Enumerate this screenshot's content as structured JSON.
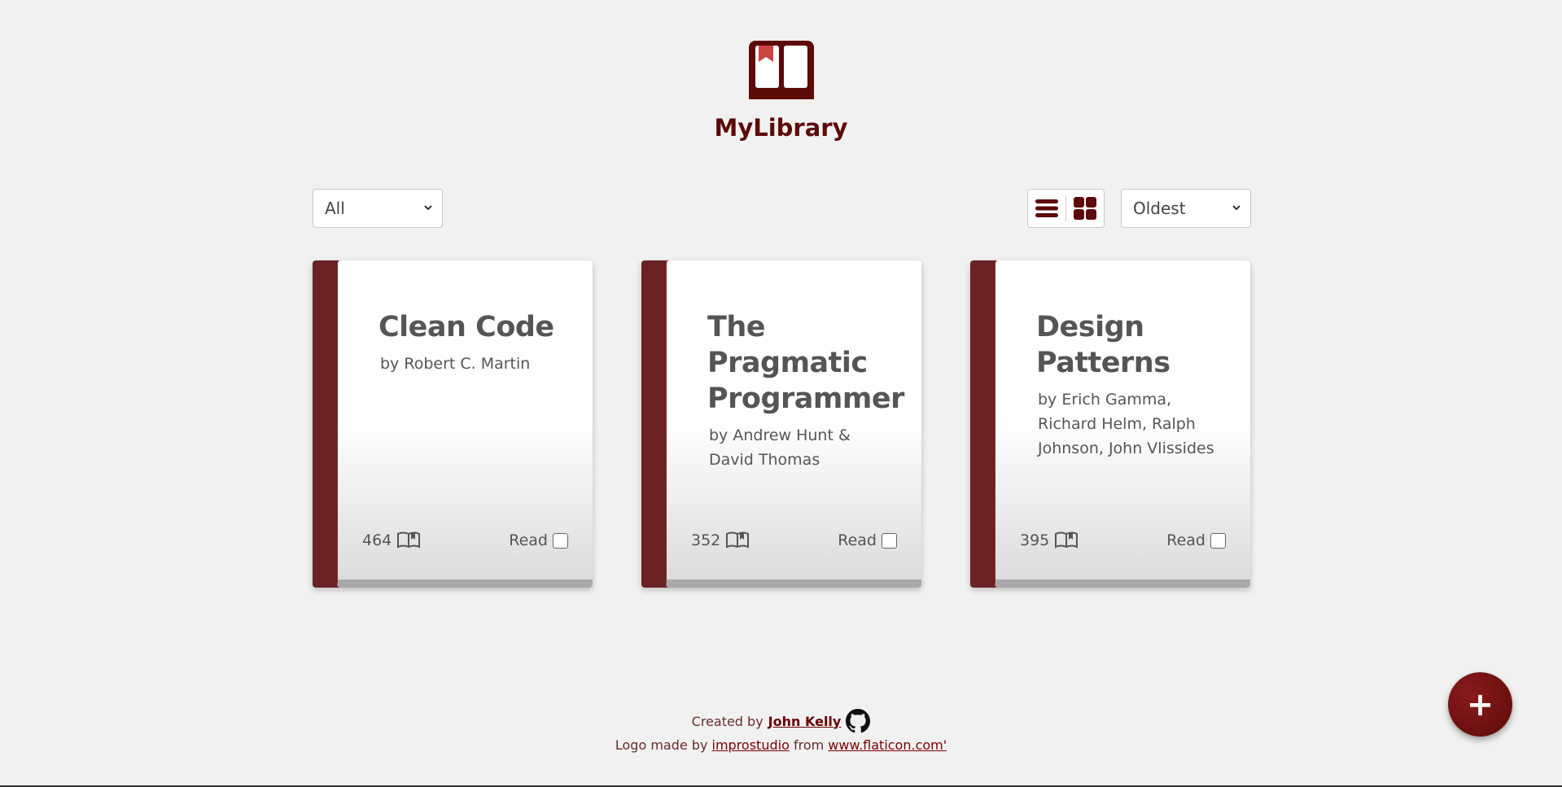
{
  "app": {
    "title": "MyLibrary",
    "logo_icon": "open-book-bookmark-icon",
    "brand_color": "#5c0a0a"
  },
  "controls": {
    "filter_value": "All",
    "sort_value": "Oldest",
    "view_list_icon": "list-view-icon",
    "view_grid_icon": "grid-view-icon"
  },
  "books": [
    {
      "title": "Clean Code",
      "author": "by Robert C. Martin",
      "pages": "464",
      "read_label": "Read",
      "read": false
    },
    {
      "title": "The Pragmatic Programmer",
      "author": "by Andrew Hunt & David Thomas",
      "pages": "352",
      "read_label": "Read",
      "read": false
    },
    {
      "title": "Design Patterns",
      "author": "by Erich Gamma, Richard Helm, Ralph Johnson, John Vlissides",
      "pages": "395",
      "read_label": "Read",
      "read": false
    }
  ],
  "footer": {
    "created_by": "Created by",
    "author_name": "John Kelly",
    "logo_made_by": "Logo made by",
    "logo_author": "improstudio",
    "from": "from",
    "site": "www.flaticon.com'"
  },
  "fab": {
    "label": "+"
  }
}
